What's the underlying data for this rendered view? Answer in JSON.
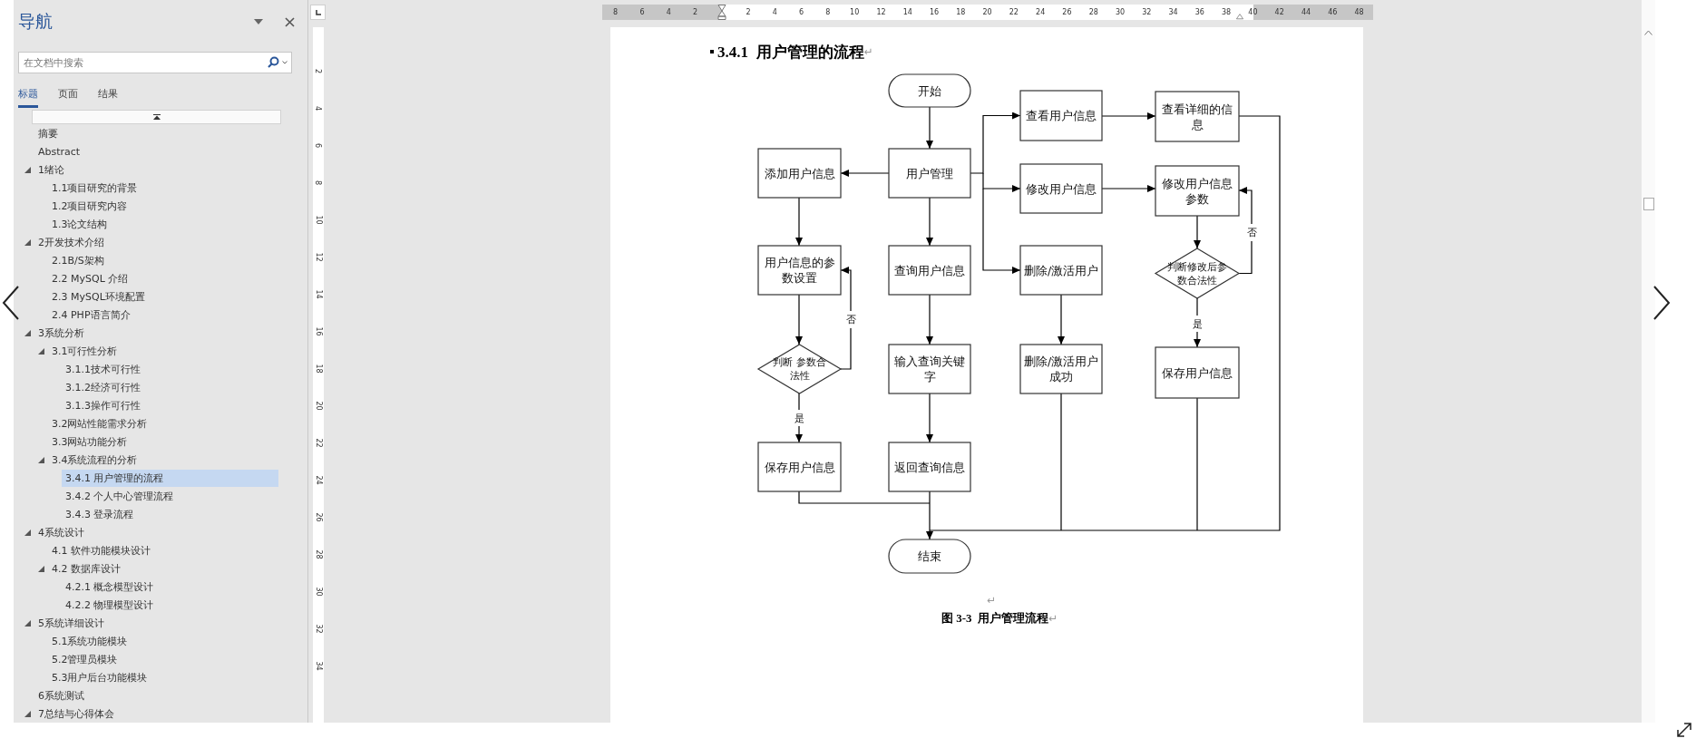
{
  "navigation": {
    "title": "导航",
    "search": {
      "placeholder": "在文档中搜索"
    },
    "tabs": [
      {
        "label": "标题",
        "selected": true
      },
      {
        "label": "页面",
        "selected": false
      },
      {
        "label": "结果",
        "selected": false
      }
    ],
    "outline": [
      {
        "text": "摘要",
        "selected": false
      },
      {
        "text": "Abstract",
        "selected": false
      },
      {
        "text": "1绪论",
        "selected": false,
        "expanded": true,
        "children": [
          {
            "text": "1.1项目研究的背景",
            "selected": false
          },
          {
            "text": "1.2项目研究内容",
            "selected": false
          },
          {
            "text": "1.3论文结构",
            "selected": false
          }
        ]
      },
      {
        "text": "2开发技术介绍",
        "selected": false,
        "expanded": true,
        "children": [
          {
            "text": "2.1B/S架构",
            "selected": false
          },
          {
            "text": "2.2 MySQL 介绍",
            "selected": false
          },
          {
            "text": "2.3 MySQL环境配置",
            "selected": false
          },
          {
            "text": "2.4 PHP语言简介",
            "selected": false
          }
        ]
      },
      {
        "text": "3系统分析",
        "selected": false,
        "expanded": true,
        "children": [
          {
            "text": "3.1可行性分析",
            "selected": false,
            "expanded": true,
            "children": [
              {
                "text": "3.1.1技术可行性",
                "selected": false
              },
              {
                "text": "3.1.2经济可行性",
                "selected": false
              },
              {
                "text": "3.1.3操作可行性",
                "selected": false
              }
            ]
          },
          {
            "text": "3.2网站性能需求分析",
            "selected": false
          },
          {
            "text": "3.3网站功能分析",
            "selected": false
          },
          {
            "text": "3.4系统流程的分析",
            "selected": false,
            "expanded": true,
            "children": [
              {
                "text": "3.4.1 用户管理的流程",
                "selected": true
              },
              {
                "text": "3.4.2 个人中心管理流程",
                "selected": false
              },
              {
                "text": "3.4.3 登录流程",
                "selected": false
              }
            ]
          }
        ]
      },
      {
        "text": "4系统设计",
        "selected": false,
        "expanded": true,
        "children": [
          {
            "text": "4.1 软件功能模块设计",
            "selected": false
          },
          {
            "text": "4.2 数据库设计",
            "selected": false,
            "expanded": true,
            "children": [
              {
                "text": "4.2.1 概念模型设计",
                "selected": false
              },
              {
                "text": "4.2.2 物理模型设计",
                "selected": false
              }
            ]
          }
        ]
      },
      {
        "text": "5系统详细设计",
        "selected": false,
        "expanded": true,
        "children": [
          {
            "text": "5.1系统功能模块",
            "selected": false
          },
          {
            "text": "5.2管理员模块",
            "selected": false
          },
          {
            "text": "5.3用户后台功能模块",
            "selected": false
          }
        ]
      },
      {
        "text": "6系统测试",
        "selected": false
      },
      {
        "text": "7总结与心得体会",
        "selected": false,
        "expanded": true
      }
    ]
  },
  "ruler": {
    "left_numbers": [
      "8",
      "6",
      "4",
      "2"
    ],
    "right_numbers": [
      "2",
      "4",
      "6",
      "8",
      "10",
      "12",
      "14",
      "16",
      "18",
      "20",
      "22",
      "24",
      "26",
      "28",
      "30",
      "32",
      "34",
      "36",
      "38",
      "40",
      "42",
      "44",
      "46",
      "48"
    ],
    "vertical_numbers": [
      "2",
      "4",
      "6",
      "8",
      "10",
      "12",
      "14",
      "16",
      "18",
      "20",
      "22",
      "24",
      "26",
      "28",
      "30",
      "32",
      "34"
    ]
  },
  "document": {
    "heading": "3.4.1  用户管理的流程",
    "heading_mark": "↵",
    "flowchart": {
      "nodes": [
        {
          "kind": "terminal",
          "text": "开始"
        },
        {
          "kind": "process",
          "text": "用户管理"
        },
        {
          "kind": "process",
          "text": "添加用户信息"
        },
        {
          "kind": "process",
          "text": "查看用户信息"
        },
        {
          "kind": "process",
          "text": "查看详细的信息"
        },
        {
          "kind": "process",
          "text": "修改用户信息"
        },
        {
          "kind": "process",
          "text": "修改用户信息参数"
        },
        {
          "kind": "process",
          "text": "用户信息的参数设置"
        },
        {
          "kind": "process",
          "text": "查询用户信息"
        },
        {
          "kind": "process",
          "text": "删除/激活用户"
        },
        {
          "kind": "decision",
          "text": "判断修改后参数合法性"
        },
        {
          "kind": "decision",
          "text": "判断 参数合法性"
        },
        {
          "kind": "process",
          "text": "输入查询关键字"
        },
        {
          "kind": "process",
          "text": "删除/激活用户成功"
        },
        {
          "kind": "process",
          "text": "保存用户信息"
        },
        {
          "kind": "process",
          "text": "保存用户信息"
        },
        {
          "kind": "process",
          "text": "返回查询信息"
        },
        {
          "kind": "terminal",
          "text": "结束"
        }
      ],
      "branch_labels": [
        "否",
        "是",
        "否",
        "是"
      ]
    },
    "empty_paragraph_mark": "↵",
    "caption": "图 3-3  用户管理流程",
    "caption_mark": "↵"
  }
}
